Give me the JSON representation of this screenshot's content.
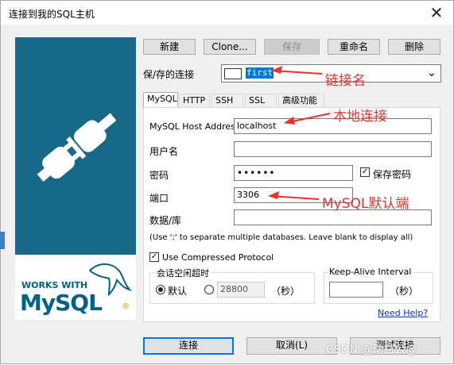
{
  "window": {
    "title": "连接到我的SQL主机",
    "close_glyph": "✕"
  },
  "toolbar": {
    "new_label": "新建",
    "clone_label": "Clone...",
    "save_label": "保存",
    "rename_label": "重命名",
    "delete_label": "删除"
  },
  "saved_connection": {
    "label": "保/存的连接",
    "value": "first",
    "chevron": "⌄"
  },
  "tabs": [
    {
      "label": "MySQL",
      "active": true
    },
    {
      "label": "HTTP"
    },
    {
      "label": "SSH"
    },
    {
      "label": "SSL"
    },
    {
      "label": "高级功能"
    }
  ],
  "form": {
    "host_label": "MySQL Host Address",
    "host_value": "localhost",
    "user_label": "用户名",
    "user_value": "",
    "password_label": "密码",
    "password_value": "••••••",
    "save_password_label": "保存密码",
    "save_password_checked": true,
    "port_label": "端口",
    "port_value": "3306",
    "database_label": "数据/库",
    "database_value": "",
    "database_hint": "(Use ';' to separate multiple databases. Leave blank to display all)",
    "compressed_label": "Use Compressed Protocol",
    "compressed_checked": true,
    "session_group_title": "会话空闲超时",
    "session_default_label": "默认",
    "session_default_selected": true,
    "session_value": "28800",
    "session_unit": "（秒）",
    "keepalive_group_title": "Keep-Alive Interval",
    "keepalive_value": "",
    "keepalive_unit": "（秒）",
    "need_help": "Need Help?"
  },
  "annotations": {
    "connection_name": "链接名",
    "local_connection": "本地连接",
    "default_port": "MySQL默认端"
  },
  "logo": {
    "works_with": "WORKS WITH",
    "mysql": "MySQL",
    "registered": "®"
  },
  "footer": {
    "connect_label": "连接",
    "cancel_label": "取消(L)",
    "test_label": "测试连接"
  },
  "watermark": "CSDN @动益公@",
  "colors": {
    "brand_blue": "#176987",
    "accent_red": "#e8322d",
    "mysql_blue": "#00618a",
    "mysql_orange": "#e48e00",
    "selection": "#0078d7"
  }
}
